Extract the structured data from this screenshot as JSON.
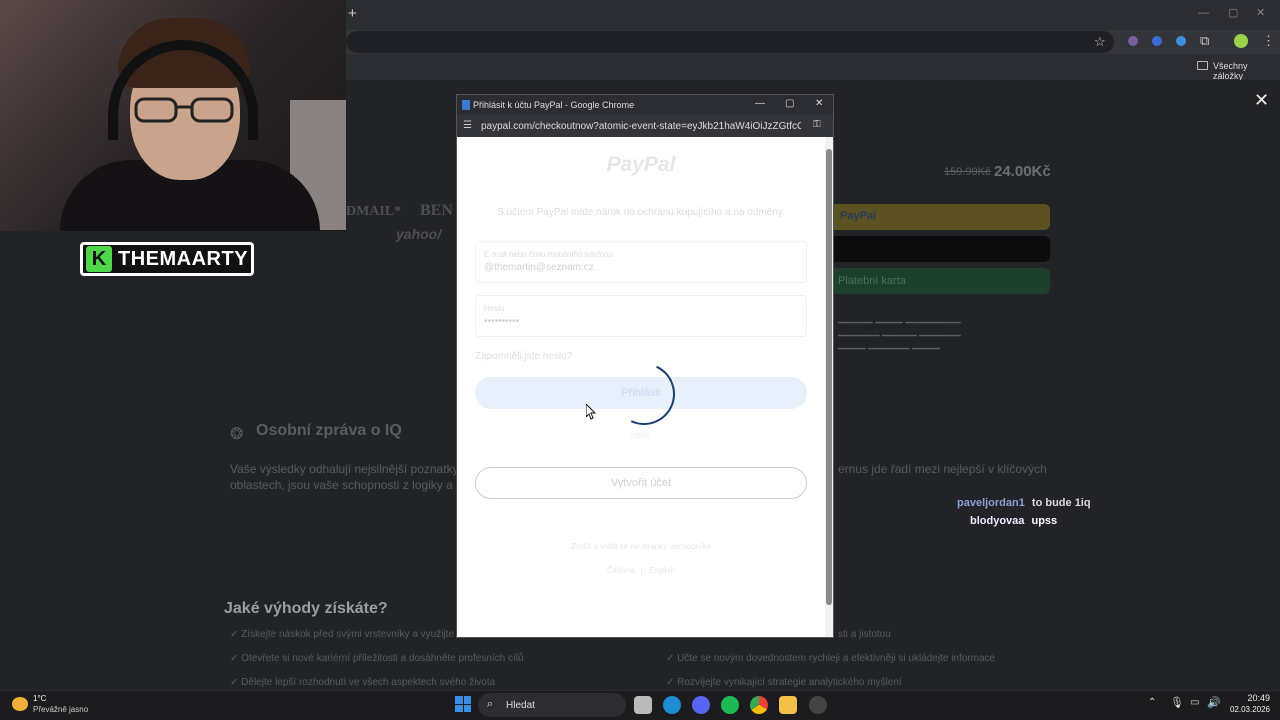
{
  "browser": {
    "new_tab_symbol": "+",
    "bookmarks_folder_label": "Všechny záložky"
  },
  "stream": {
    "logo_text": "THEMAARTY",
    "logo_letter": "K"
  },
  "popup": {
    "window_title": "Přihlásit k účtu PayPal - Google Chrome",
    "url": "paypal.com/checkoutnow?atomic-event-state=eyJkb21haW4iOiJzZGtfcGF5c...",
    "brand": "PayPal",
    "subtitle": "S účtem PayPal máte nárok na ochranu kupujícího a na odměny.",
    "email_label": "E-mail nebo číslo mobilního telefonu",
    "email_value": "@themartin@seznam.cz",
    "password_label": "Heslo",
    "password_value": "••••••••••",
    "forgot_link": "Zapomněli jste heslo?",
    "login_button": "Přihlásit",
    "or_text": "nebo",
    "create_account_button": "Vytvořit účet",
    "footer_note": "Zrušit a vrátit se na stránky obchodníka",
    "footer_links": [
      "Čeština",
      "English"
    ]
  },
  "page": {
    "old_price": "159.99Kč",
    "price": "24.00Kč",
    "button_paypal": "PayPal",
    "button_card": "Platební karta",
    "section_title": "Osobní zpráva o IQ",
    "section_text_1": "Vaše výsledky odhalují nejsilnější poznatky",
    "section_text_2": "oblastech, jsou vaše schopnosti z logiky a ře",
    "benefits_title": "Jaké výhody získáte?",
    "benefits_left": [
      "Získejte náskok před svými vrstevníky a využijte",
      "Otevřete si nové kariérní příležitosti a dosáhněte profesních cílů",
      "Dělejte lepší rozhodnutí ve všech aspektech svého života"
    ],
    "benefits_right": [
      "sti a jistotou",
      "Učte se novým dovednostem rychleji a efektivněji si ukládejte informace",
      "Rozvíjejte vynikající strategie analytického myšlení"
    ],
    "right_paragraph_tail": "ernus jde řadí mezi nejlepší v klíčových",
    "brand_partial": "DMAIL*",
    "brand_partial_2": "BEN",
    "brand_partial_3": "yahoo/"
  },
  "chat": [
    {
      "user": "paveljordan1",
      "message": "to bude 1iq",
      "user_color": "#8d9fd6"
    },
    {
      "user": "blodyovaa",
      "message": "upss",
      "user_color": "#f0e8ff"
    }
  ],
  "taskbar": {
    "weather_temp": "1°C",
    "weather_desc": "Převážně jasno",
    "search_placeholder": "Hledat",
    "time": "20:49",
    "date": "02.03.2026"
  }
}
